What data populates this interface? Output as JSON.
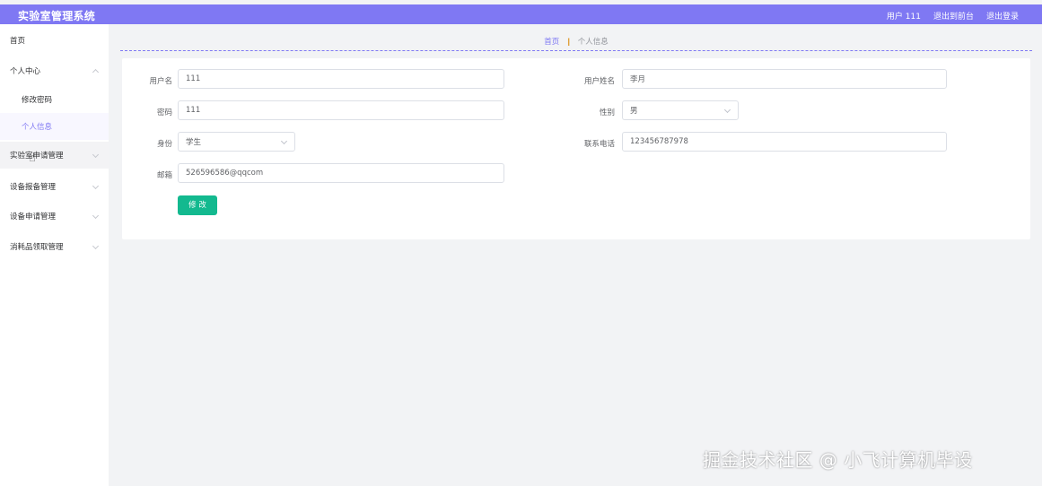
{
  "header": {
    "title": "实验室管理系统",
    "user": "用户 111",
    "backstage_link": "退出到前台",
    "logout_link": "退出登录"
  },
  "sidebar": {
    "items": [
      {
        "label": "首页"
      },
      {
        "label": "个人中心"
      },
      {
        "label": "修改密码"
      },
      {
        "label": "个人信息"
      },
      {
        "label": "实验室申请管理"
      },
      {
        "label": "设备报备管理"
      },
      {
        "label": "设备申请管理"
      },
      {
        "label": "消耗品领取管理"
      }
    ]
  },
  "breadcrumb": {
    "home": "首页",
    "current": "个人信息"
  },
  "form": {
    "username_label": "用户名",
    "username_value": "111",
    "realname_label": "用户姓名",
    "realname_value": "李月",
    "password_label": "密码",
    "password_value": "111",
    "gender_label": "性别",
    "gender_value": "男",
    "identity_label": "身份",
    "identity_value": "学生",
    "phone_label": "联系电话",
    "phone_value": "123456787978",
    "email_label": "邮箱",
    "email_value": "526596586@qqcom",
    "submit_label": "修 改"
  },
  "colors": {
    "accent": "#7f78f3",
    "button": "#13b98f"
  },
  "watermark": "掘金技术社区 @ 小飞计算机毕设"
}
